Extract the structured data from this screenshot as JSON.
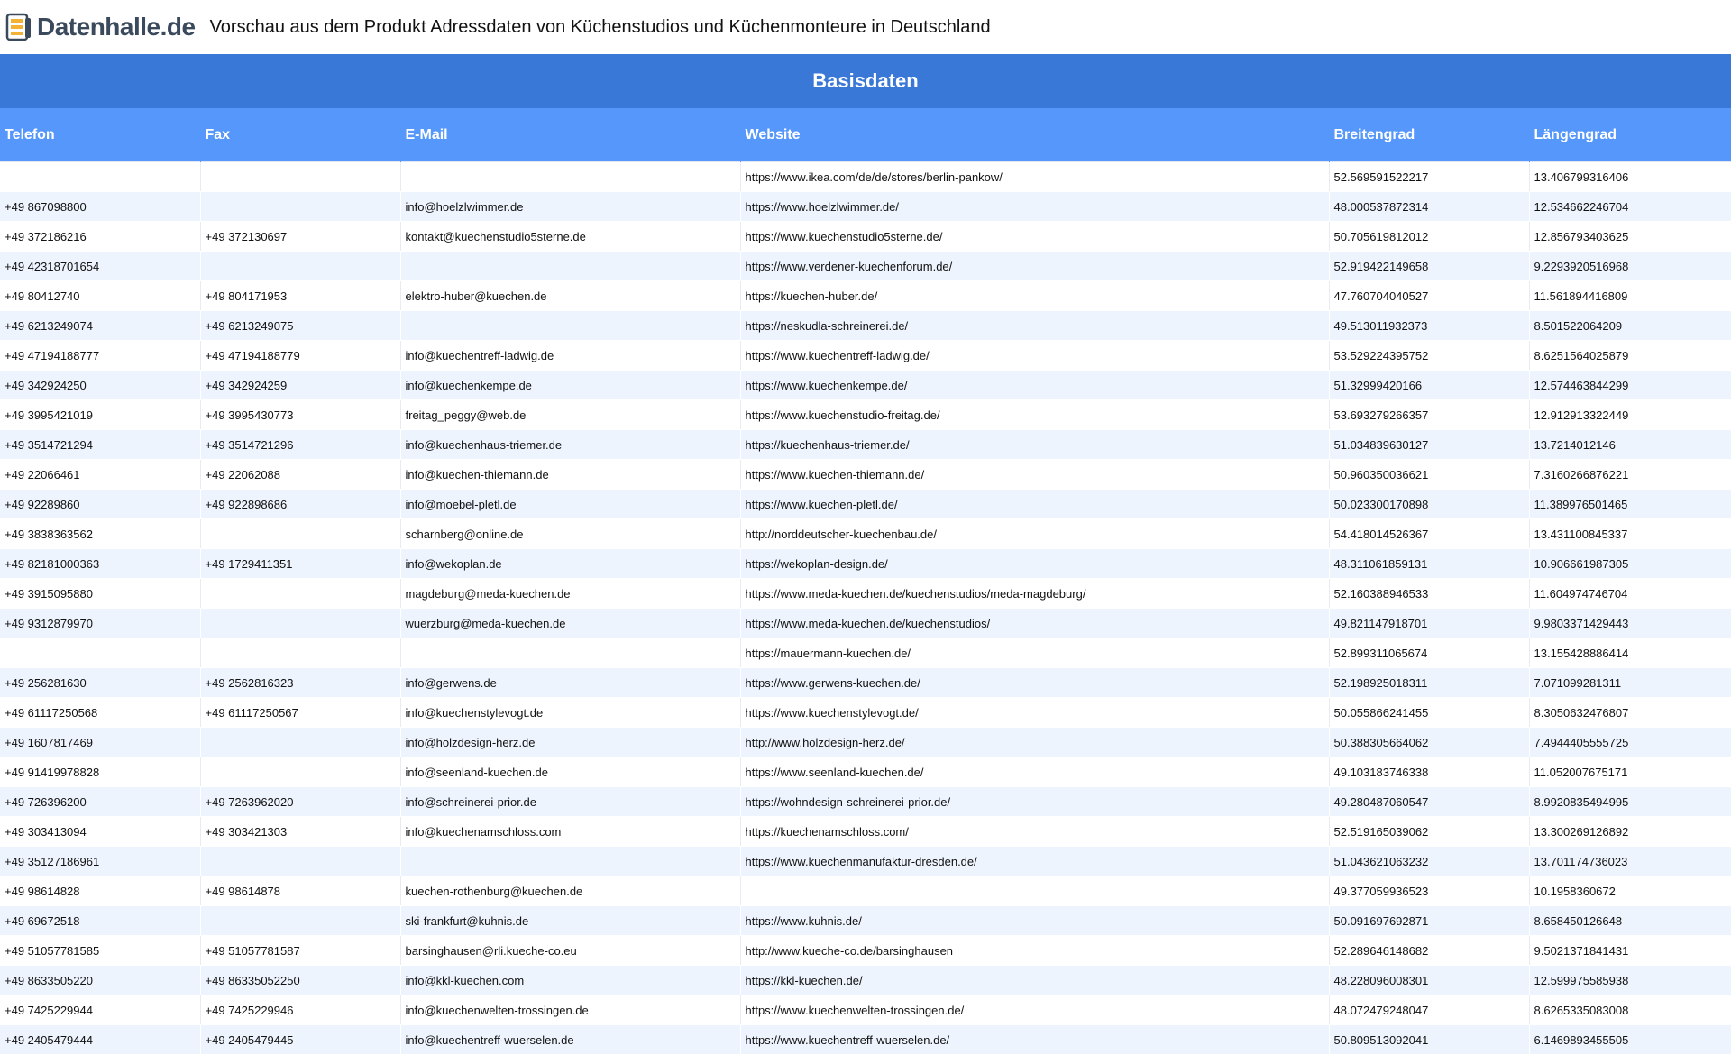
{
  "header": {
    "logo_text": "Datenhalle.de",
    "title": "Vorschau aus dem Produkt Adressdaten von Küchenstudios und Küchenmonteure in Deutschland"
  },
  "band": {
    "label": "Basisdaten"
  },
  "colors": {
    "band": "#3a78d8",
    "header_row": "#5597fb",
    "row_alt": "#eef4fd"
  },
  "columns": [
    "Telefon",
    "Fax",
    "E-Mail",
    "Website",
    "Breitengrad",
    "Längengrad"
  ],
  "rows": [
    [
      "",
      "",
      "",
      "https://www.ikea.com/de/de/stores/berlin-pankow/",
      "52.569591522217",
      "13.406799316406"
    ],
    [
      "+49 867098800",
      "",
      "info@hoelzlwimmer.de",
      "https://www.hoelzlwimmer.de/",
      "48.000537872314",
      "12.534662246704"
    ],
    [
      "+49 372186216",
      "+49 372130697",
      "kontakt@kuechenstudio5sterne.de",
      "https://www.kuechenstudio5sterne.de/",
      "50.705619812012",
      "12.856793403625"
    ],
    [
      "+49 42318701654",
      "",
      "",
      "https://www.verdener-kuechenforum.de/",
      "52.919422149658",
      "9.2293920516968"
    ],
    [
      "+49 80412740",
      "+49 804171953",
      "elektro-huber@kuechen.de",
      "https://kuechen-huber.de/",
      "47.760704040527",
      "11.561894416809"
    ],
    [
      "+49 6213249074",
      "+49 6213249075",
      "",
      "https://neskudla-schreinerei.de/",
      "49.513011932373",
      "8.501522064209"
    ],
    [
      "+49 47194188777",
      "+49 47194188779",
      "info@kuechentreff-ladwig.de",
      "https://www.kuechentreff-ladwig.de/",
      "53.529224395752",
      "8.6251564025879"
    ],
    [
      "+49 342924250",
      "+49 342924259",
      "info@kuechenkempe.de",
      "https://www.kuechenkempe.de/",
      "51.32999420166",
      "12.574463844299"
    ],
    [
      "+49 3995421019",
      "+49 3995430773",
      "freitag_peggy@web.de",
      "https://www.kuechenstudio-freitag.de/",
      "53.693279266357",
      "12.912913322449"
    ],
    [
      "+49 3514721294",
      "+49 3514721296",
      "info@kuechenhaus-triemer.de",
      "https://kuechenhaus-triemer.de/",
      "51.034839630127",
      "13.7214012146"
    ],
    [
      "+49 22066461",
      "+49 22062088",
      "info@kuechen-thiemann.de",
      "https://www.kuechen-thiemann.de/",
      "50.960350036621",
      "7.3160266876221"
    ],
    [
      "+49 92289860",
      "+49 922898686",
      "info@moebel-pletl.de",
      "https://www.kuechen-pletl.de/",
      "50.023300170898",
      "11.389976501465"
    ],
    [
      "+49 3838363562",
      "",
      "scharnberg@online.de",
      "http://norddeutscher-kuechenbau.de/",
      "54.418014526367",
      "13.431100845337"
    ],
    [
      "+49 82181000363",
      "+49 1729411351",
      "info@wekoplan.de",
      "https://wekoplan-design.de/",
      "48.311061859131",
      "10.906661987305"
    ],
    [
      "+49 3915095880",
      "",
      "magdeburg@meda-kuechen.de",
      "https://www.meda-kuechen.de/kuechenstudios/meda-magdeburg/",
      "52.160388946533",
      "11.604974746704"
    ],
    [
      "+49 9312879970",
      "",
      "wuerzburg@meda-kuechen.de",
      "https://www.meda-kuechen.de/kuechenstudios/",
      "49.821147918701",
      "9.9803371429443"
    ],
    [
      "",
      "",
      "",
      "https://mauermann-kuechen.de/",
      "52.899311065674",
      "13.155428886414"
    ],
    [
      "+49 256281630",
      "+49 2562816323",
      "info@gerwens.de",
      "https://www.gerwens-kuechen.de/",
      "52.198925018311",
      "7.071099281311"
    ],
    [
      "+49 61117250568",
      "+49 61117250567",
      "info@kuechenstylevogt.de",
      "https://www.kuechenstylevogt.de/",
      "50.055866241455",
      "8.3050632476807"
    ],
    [
      "+49 1607817469",
      "",
      "info@holzdesign-herz.de",
      "http://www.holzdesign-herz.de/",
      "50.388305664062",
      "7.4944405555725"
    ],
    [
      "+49 91419978828",
      "",
      "info@seenland-kuechen.de",
      "https://www.seenland-kuechen.de/",
      "49.103183746338",
      "11.052007675171"
    ],
    [
      "+49 726396200",
      "+49 7263962020",
      "info@schreinerei-prior.de",
      "https://wohndesign-schreinerei-prior.de/",
      "49.280487060547",
      "8.9920835494995"
    ],
    [
      "+49 303413094",
      "+49 303421303",
      "info@kuechenamschloss.com",
      "https://kuechenamschloss.com/",
      "52.519165039062",
      "13.300269126892"
    ],
    [
      "+49 35127186961",
      "",
      "",
      "https://www.kuechenmanufaktur-dresden.de/",
      "51.043621063232",
      "13.701174736023"
    ],
    [
      "+49 98614828",
      "+49 98614878",
      "kuechen-rothenburg@kuechen.de",
      "",
      "49.377059936523",
      "10.1958360672"
    ],
    [
      "+49 69672518",
      "",
      "ski-frankfurt@kuhnis.de",
      "https://www.kuhnis.de/",
      "50.091697692871",
      "8.658450126648"
    ],
    [
      "+49 51057781585",
      "+49 51057781587",
      "barsinghausen@rli.kueche-co.eu",
      "http://www.kueche-co.de/barsinghausen",
      "52.289646148682",
      "9.5021371841431"
    ],
    [
      "+49 8633505220",
      "+49 86335052250",
      "info@kkl-kuechen.com",
      "https://kkl-kuechen.de/",
      "48.228096008301",
      "12.599975585938"
    ],
    [
      "+49 7425229944",
      "+49 7425229946",
      "info@kuechenwelten-trossingen.de",
      "https://www.kuechenwelten-trossingen.de/",
      "48.072479248047",
      "8.6265335083008"
    ],
    [
      "+49 2405479444",
      "+49 2405479445",
      "info@kuechentreff-wuerselen.de",
      "https://www.kuechentreff-wuerselen.de/",
      "50.809513092041",
      "6.1469893455505"
    ]
  ]
}
